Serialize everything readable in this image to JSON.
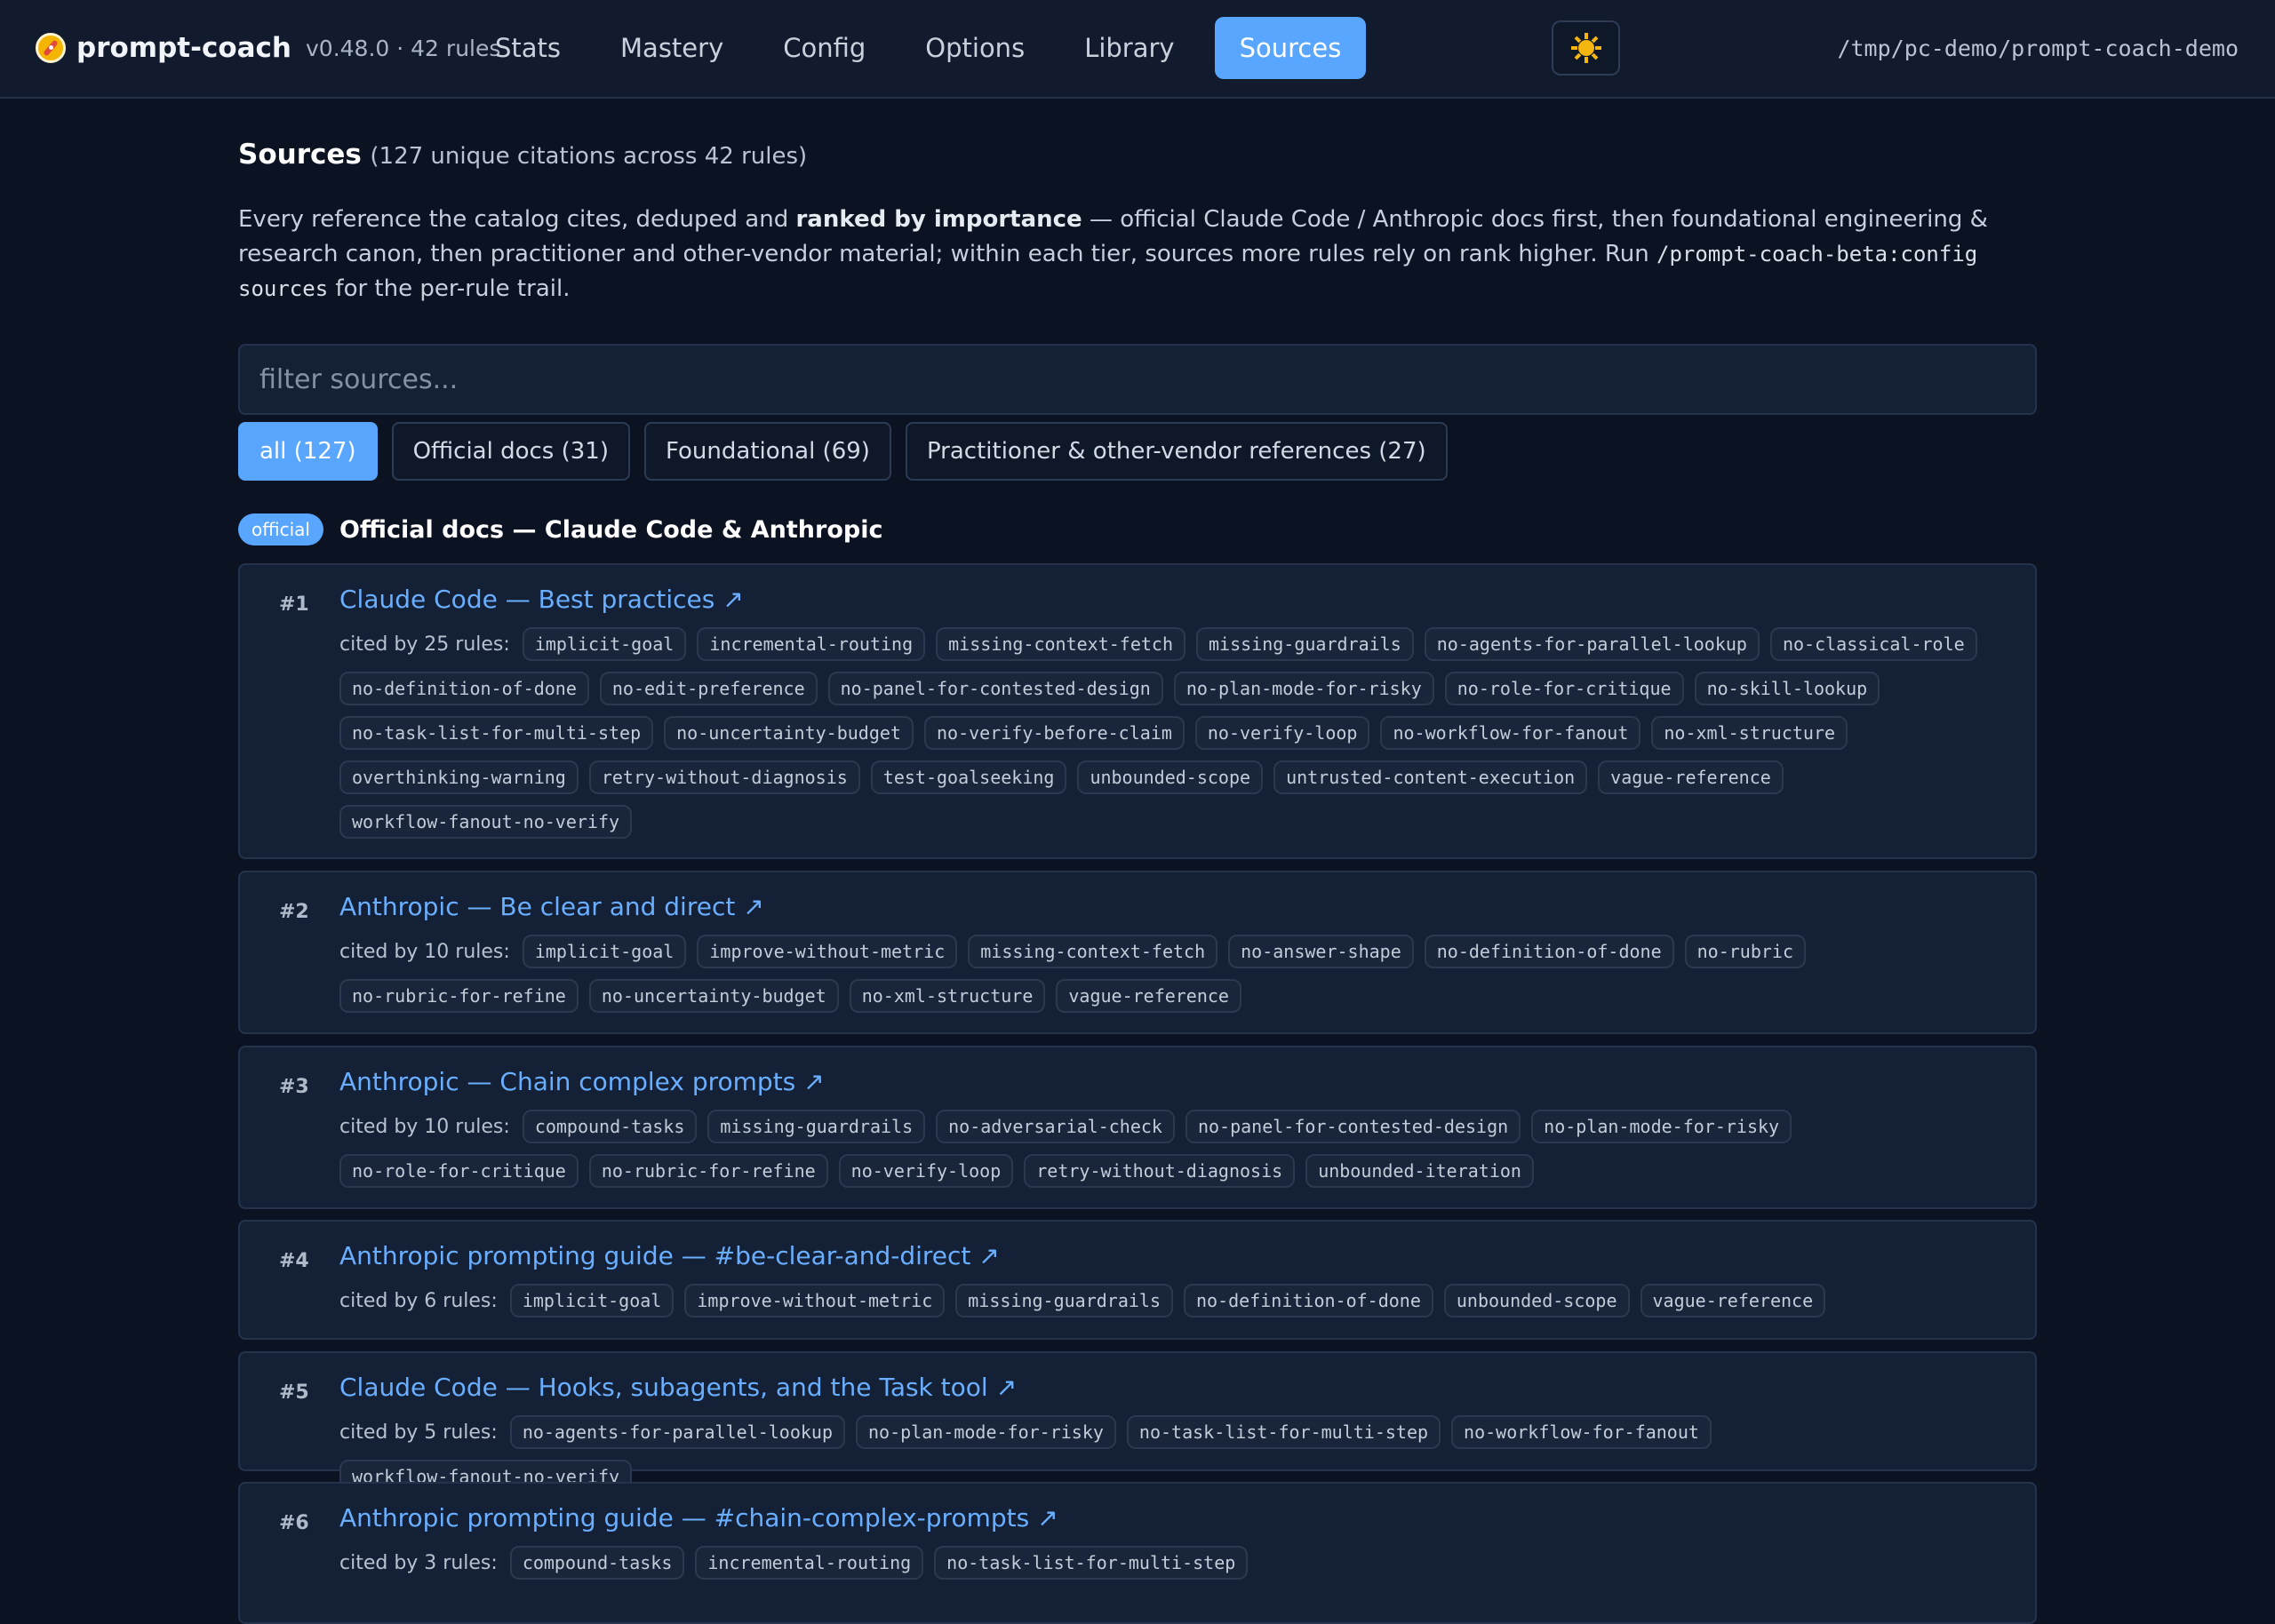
{
  "app": {
    "name": "prompt-coach",
    "version": "v0.48.0 · 42 rules",
    "path": "/tmp/pc-demo/prompt-coach-demo"
  },
  "nav": [
    "Stats",
    "Mastery",
    "Config",
    "Options",
    "Library",
    "Sources"
  ],
  "nav_active": "Sources",
  "page": {
    "title": "Sources",
    "count": "(127 unique citations across 42 rules)",
    "intro_1": "Every reference the catalog cites, deduped and ",
    "intro_bold": "ranked by importance",
    "intro_2": " — official Claude Code / Anthropic docs first, then foundational engineering & research canon, then practitioner and other-vendor material; within each tier, sources more rules rely on rank higher. Run ",
    "intro_code": "/prompt-coach-beta:config sources",
    "intro_3": " for the per-rule trail.",
    "filter_placeholder": "filter sources..."
  },
  "chips": [
    "all (127)",
    "Official docs (31)",
    "Foundational (69)",
    "Practitioner & other-vendor references (27)"
  ],
  "section": {
    "badge": "official",
    "title": "Official docs — Claude Code & Anthropic"
  },
  "sources": [
    {
      "rank": "#1",
      "title": "Claude Code — Best practices ↗",
      "cited": "cited by 25 rules:",
      "tags": [
        "implicit-goal",
        "incremental-routing",
        "missing-context-fetch",
        "missing-guardrails",
        "no-agents-for-parallel-lookup",
        "no-classical-role",
        "no-definition-of-done",
        "no-edit-preference",
        "no-panel-for-contested-design",
        "no-plan-mode-for-risky",
        "no-role-for-critique",
        "no-skill-lookup",
        "no-task-list-for-multi-step",
        "no-uncertainty-budget",
        "no-verify-before-claim",
        "no-verify-loop",
        "no-workflow-for-fanout",
        "no-xml-structure",
        "overthinking-warning",
        "retry-without-diagnosis",
        "test-goalseeking",
        "unbounded-scope",
        "untrusted-content-execution",
        "vague-reference",
        "workflow-fanout-no-verify"
      ]
    },
    {
      "rank": "#2",
      "title": "Anthropic — Be clear and direct ↗",
      "cited": "cited by 10 rules:",
      "tags": [
        "implicit-goal",
        "improve-without-metric",
        "missing-context-fetch",
        "no-answer-shape",
        "no-definition-of-done",
        "no-rubric",
        "no-rubric-for-refine",
        "no-uncertainty-budget",
        "no-xml-structure",
        "vague-reference"
      ]
    },
    {
      "rank": "#3",
      "title": "Anthropic — Chain complex prompts ↗",
      "cited": "cited by 10 rules:",
      "tags": [
        "compound-tasks",
        "missing-guardrails",
        "no-adversarial-check",
        "no-panel-for-contested-design",
        "no-plan-mode-for-risky",
        "no-role-for-critique",
        "no-rubric-for-refine",
        "no-verify-loop",
        "retry-without-diagnosis",
        "unbounded-iteration"
      ]
    },
    {
      "rank": "#4",
      "title": "Anthropic prompting guide — #be-clear-and-direct ↗",
      "cited": "cited by 6 rules:",
      "tags": [
        "implicit-goal",
        "improve-without-metric",
        "missing-guardrails",
        "no-definition-of-done",
        "unbounded-scope",
        "vague-reference"
      ]
    },
    {
      "rank": "#5",
      "title": "Claude Code — Hooks, subagents, and the Task tool ↗",
      "cited": "cited by 5 rules:",
      "tags": [
        "no-agents-for-parallel-lookup",
        "no-plan-mode-for-risky",
        "no-task-list-for-multi-step",
        "no-workflow-for-fanout",
        "workflow-fanout-no-verify"
      ]
    },
    {
      "rank": "#6",
      "title": "Anthropic prompting guide — #chain-complex-prompts ↗",
      "cited": "cited by 3 rules:",
      "tags": [
        "compound-tasks",
        "incremental-routing",
        "no-task-list-for-multi-step"
      ]
    }
  ]
}
